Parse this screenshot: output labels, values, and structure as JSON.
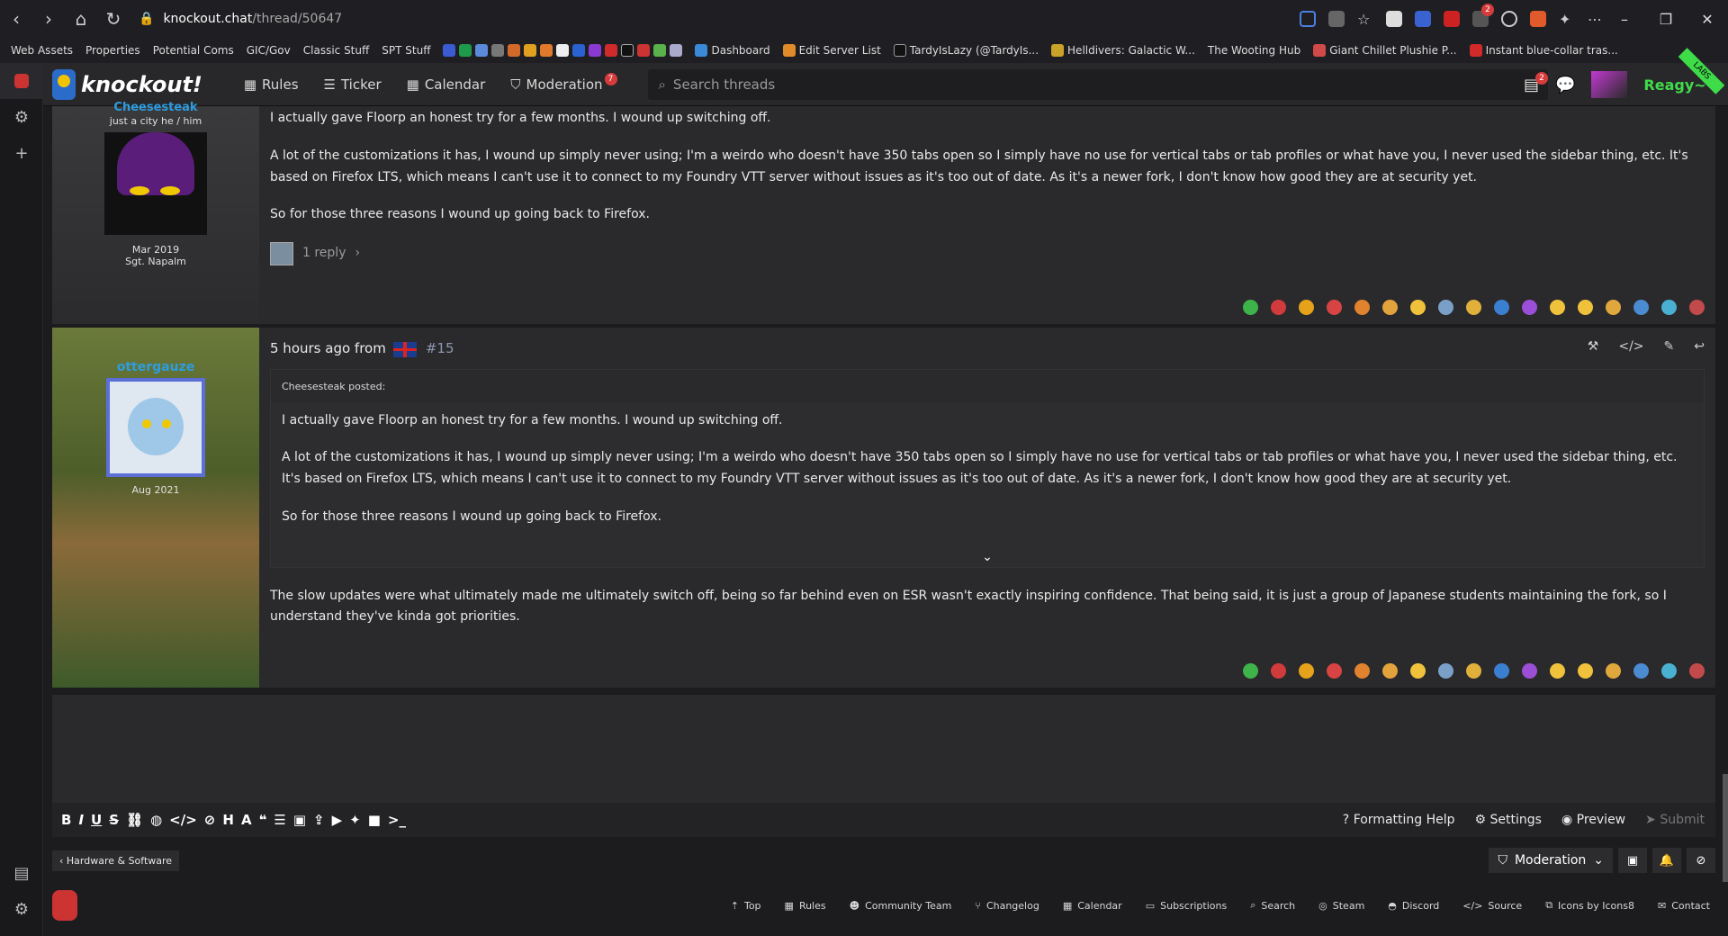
{
  "browser": {
    "url_host": "knockout.chat",
    "url_path": "/thread/50647",
    "ext_badge": "2"
  },
  "bookmarks": [
    "Web Assets",
    "Properties",
    "Potential Coms",
    "GIC/Gov",
    "Classic Stuff",
    "SPT Stuff",
    "Dashboard",
    "Edit Server List",
    "TardyIsLazy (@TardyIs...",
    "Helldivers: Galactic W...",
    "The Wooting Hub",
    "Giant Chillet Plushie P...",
    "Instant blue-collar tras..."
  ],
  "header": {
    "logo": "knockout!",
    "nav": {
      "rules": "Rules",
      "ticker": "Ticker",
      "calendar": "Calendar",
      "moderation": "Moderation",
      "moderation_badge": "7"
    },
    "search_placeholder": "Search threads",
    "notif_badge": "2",
    "username": "Reagy~♥",
    "labs": "LABS"
  },
  "post1": {
    "username": "Cheesesteak",
    "title": "just a city he / him",
    "joined": "Mar 2019",
    "rank": "Sgt. Napalm",
    "paragraphs": [
      "I actually gave Floorp an honest try for a few months. I wound up switching off.",
      "A lot of the customizations it has, I wound up simply never using; I'm a weirdo who doesn't have 350 tabs open so I simply have no use for vertical tabs or tab profiles or what have you, I never used the sidebar thing, etc. It's based on Firefox LTS, which means I can't use it to connect to my Foundry VTT server without issues as it's too out of date. As it's a newer fork, I don't know how good they are at security yet.",
      "So for those three reasons I wound up going back to Firefox."
    ],
    "reply_count": "1 reply"
  },
  "post2": {
    "username": "ottergauze",
    "joined": "Aug 2021",
    "meta_time": "5 hours ago from",
    "number": "#15",
    "quote_head": "Cheesesteak  posted:",
    "quote_paragraphs": [
      "I actually gave Floorp an honest try for a few months. I wound up switching off.",
      "A lot of the customizations it has, I wound up simply never using; I'm a weirdo who doesn't have 350 tabs open so I simply have no use for vertical tabs or tab profiles or what have you, I never used the sidebar thing, etc. It's based on Firefox LTS, which means I can't use it to connect to my Foundry VTT server without issues as it's too out of date. As it's a newer fork, I don't know how good they are at security yet.",
      "So for those three reasons I wound up going back to Firefox."
    ],
    "body": "The slow updates were what ultimately made me ultimately switch off, being so far behind even on ESR wasn't exactly inspiring confidence. That being said, it is just a group of Japanese students maintaining the fork, so I understand they've kinda got priorities."
  },
  "reaction_colors": [
    "#3db34a",
    "#d13b3b",
    "#e6a21a",
    "#d84343",
    "#e0822e",
    "#e3a33c",
    "#f0c23c",
    "#7aa0c8",
    "#e0b03b",
    "#3b7fd1",
    "#9b4fd6",
    "#f0c23c",
    "#f0c23c",
    "#e0a83c",
    "#4a8bd1",
    "#4ab0d1",
    "#c34a4a"
  ],
  "editor": {
    "formatting_help": "Formatting Help",
    "settings": "Settings",
    "preview": "Preview",
    "submit": "Submit"
  },
  "subnav": {
    "breadcrumb": "‹ Hardware & Software",
    "moderation": "Moderation"
  },
  "footer": {
    "links": [
      "Top",
      "Rules",
      "Community Team",
      "Changelog",
      "Calendar",
      "Subscriptions",
      "Search",
      "Steam",
      "Discord",
      "Source",
      "Icons by Icons8",
      "Contact"
    ]
  }
}
